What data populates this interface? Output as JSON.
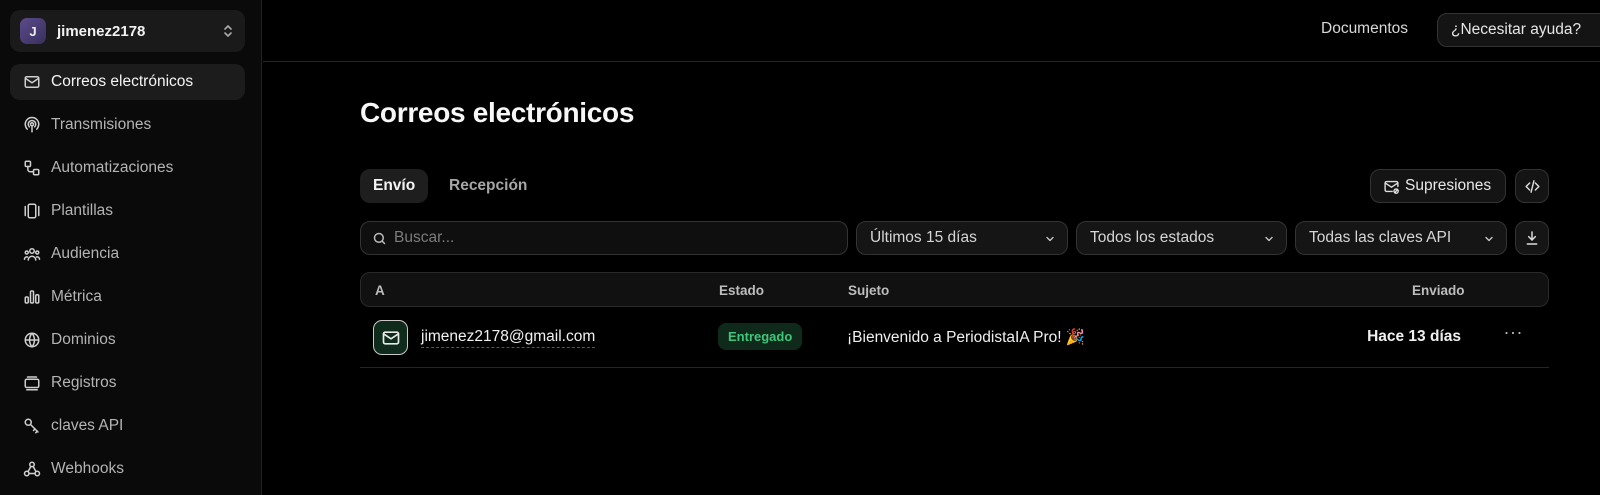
{
  "account": {
    "initial": "J",
    "name": "jimenez2178"
  },
  "sidebar": {
    "items": [
      {
        "label": "Correos electrónicos",
        "icon": "mail-icon",
        "active": true
      },
      {
        "label": "Transmisiones",
        "icon": "broadcast-icon",
        "active": false
      },
      {
        "label": "Automatizaciones",
        "icon": "workflow-icon",
        "active": false
      },
      {
        "label": "Plantillas",
        "icon": "templates-icon",
        "active": false
      },
      {
        "label": "Audiencia",
        "icon": "users-icon",
        "active": false
      },
      {
        "label": "Métrica",
        "icon": "bar-chart-icon",
        "active": false
      },
      {
        "label": "Dominios",
        "icon": "globe-icon",
        "active": false
      },
      {
        "label": "Registros",
        "icon": "logs-icon",
        "active": false
      },
      {
        "label": "claves API",
        "icon": "key-icon",
        "active": false
      },
      {
        "label": "Webhooks",
        "icon": "webhook-icon",
        "active": false
      }
    ]
  },
  "topbar": {
    "docs_label": "Documentos",
    "help_label": "¿Necesitar ayuda?"
  },
  "main": {
    "title": "Correos electrónicos",
    "tabs": [
      {
        "label": "Envío",
        "active": true
      },
      {
        "label": "Recepción",
        "active": false
      }
    ],
    "suppressions_label": "Supresiones",
    "search": {
      "placeholder": "Buscar...",
      "value": ""
    },
    "filters": {
      "range": "Últimos 15 días",
      "status": "Todos los estados",
      "api_key": "Todas las claves API"
    },
    "table": {
      "columns": {
        "to": "A",
        "status": "Estado",
        "subject": "Sujeto",
        "sent": "Enviado"
      },
      "rows": [
        {
          "to": "jimenez2178@gmail.com",
          "status": "Entregado",
          "subject": "¡Bienvenido a PeriodistaIA Pro! 🎉",
          "sent": "Hace 13 días",
          "more": "···"
        }
      ]
    }
  },
  "colors": {
    "status_delivered": "#3ec77a",
    "background": "#000000",
    "sidebar": "#0a0a0a"
  }
}
